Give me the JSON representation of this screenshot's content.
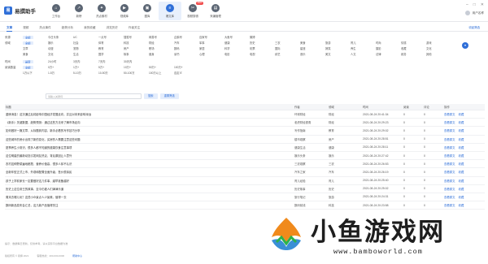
{
  "app": {
    "logo_text": "易",
    "name": "易撰助手"
  },
  "nav": [
    {
      "label": "工作台",
      "icon": "home-icon",
      "glyph": "⌂"
    },
    {
      "label": "新榜",
      "icon": "trend-icon",
      "glyph": "↗"
    },
    {
      "label": "热点素材",
      "icon": "fire-icon",
      "glyph": "✦"
    },
    {
      "label": "视频库",
      "icon": "video-icon",
      "glyph": "▶"
    },
    {
      "label": "图库",
      "icon": "image-icon",
      "glyph": "▣"
    },
    {
      "label": "爆文库",
      "icon": "article-icon",
      "glyph": "≡",
      "active": true
    },
    {
      "label": "视频剪辑",
      "icon": "scissors-icon",
      "glyph": "✂",
      "badge": "NEW"
    },
    {
      "label": "采编管理",
      "icon": "folder-icon",
      "glyph": "▤"
    }
  ],
  "window": {
    "min": "–",
    "max": "□",
    "close": "✕"
  },
  "user": {
    "name": "用户名称"
  },
  "tabs": [
    "文章",
    "视频",
    "热点事件",
    "趋势分析",
    "我的收藏",
    "浏览历史",
    "作者关注"
  ],
  "tabs_right": "收起筛选",
  "filters": {
    "source": {
      "label": "来源",
      "options": [
        "全部",
        "今日头条",
        "UC",
        "一点号",
        "搜狐号",
        "网易号",
        "企鹅号",
        "百家号",
        "大鱼号",
        "微博"
      ]
    },
    "category": {
      "label": "领域",
      "rows": [
        [
          "全部",
          "娱乐",
          "社会",
          "体育",
          "科技",
          "财经",
          "汽车",
          "军事",
          "健康",
          "历史",
          "三农",
          "美食",
          "旅游",
          "育儿",
          "时尚",
          "情感",
          "游戏"
        ],
        [
          "文章",
          "动漫",
          "宠物",
          "教育",
          "房产",
          "职场",
          "数码",
          "家居",
          "科学",
          "彩票",
          "国际",
          "星座",
          "搞笑",
          "养生",
          "摄影",
          "收藏",
          "文化"
        ],
        [
          "美食",
          "文化",
          "生活",
          "国学",
          "故事",
          "健身",
          "读书",
          "心理",
          "电影",
          "电视",
          "综艺",
          "音乐",
          "美文",
          "人文",
          "法律",
          "政务",
          "其他"
        ]
      ]
    },
    "time": {
      "label": "时间",
      "options": [
        "最新",
        "24小时",
        "3天内",
        "7天内",
        "30天内"
      ]
    },
    "read": {
      "label": "阅读数量",
      "rows": [
        [
          "全部",
          "0万+",
          "1万+",
          "5万+",
          "10万+",
          "50万+",
          "100万+"
        ],
        [
          "1万以下",
          "1-5万",
          "5-10万",
          "10-50万",
          "50-100万",
          "100万以上",
          "自定义"
        ]
      ]
    }
  },
  "search": {
    "placeholder": "请输入关键词",
    "button": "搜索",
    "reset": "重置筛选"
  },
  "table": {
    "headers": {
      "title": "标题",
      "author": "作者",
      "category": "领域",
      "time": "时间",
      "read": "阅读",
      "comment": "评论",
      "op": "操作"
    },
    "rows": [
      {
        "title": "重磅消息！这次通过后将影响中国经济发展走向，并且对未来影响深远",
        "author": "环球财经",
        "category": "财经",
        "time": "2021-08-24 20:41:34",
        "read": "0",
        "comment": "0",
        "op1": "查看原文",
        "op2": "收藏"
      },
      {
        "title": "《新手》关键数据，趋势预测：通过这些方法来了解市场走向",
        "author": "老虎财经视角",
        "category": "财经",
        "time": "2021-08-24 20:29:23",
        "read": "0",
        "comment": "0",
        "op1": "查看原文",
        "op2": "收藏"
      },
      {
        "title": "如何做好一篇文章，从标题到内容，新手必看的写作技巧分享",
        "author": "写作指南",
        "category": "教育",
        "time": "2021-08-24 20:29:02",
        "read": "0",
        "comment": "0",
        "op1": "查看原文",
        "op2": "收藏"
      },
      {
        "title": "这些城市的房价出现了新的变化，买房的人需要注意这些问题",
        "author": "楼市观察",
        "category": "房产",
        "time": "2021-08-24 20:28:51",
        "read": "0",
        "comment": "0",
        "op1": "查看原文",
        "op2": "收藏"
      },
      {
        "title": "夏季养生小常识，很多人都不知道的健康饮食注意事项",
        "author": "健康生活",
        "category": "健康",
        "time": "2021-08-24 20:28:11",
        "read": "0",
        "comment": "0",
        "op1": "查看原文",
        "op2": "收藏"
      },
      {
        "title": "这位明星的最新动态引发网友热议，背后原因让人意外",
        "author": "娱乐头条",
        "category": "娱乐",
        "time": "2021-08-24 20:27:42",
        "read": "0",
        "comment": "0",
        "op1": "查看原文",
        "op2": "收藏"
      },
      {
        "title": "农村这种野菜遍地都是，营养价值高，很多人却不认识",
        "author": "三农观察",
        "category": "三农",
        "time": "2021-08-24 20:26:53",
        "read": "0",
        "comment": "0",
        "op1": "查看原文",
        "op2": "收藏"
      },
      {
        "title": "全新车型正式上市，外观和配置全面升级，售价很亲民",
        "author": "汽车之家",
        "category": "汽车",
        "time": "2021-08-24 20:26:19",
        "read": "0",
        "comment": "0",
        "op1": "查看原文",
        "op2": "收藏"
      },
      {
        "title": "孩子上学前家长一定要做好这几件事，越早准备越好",
        "author": "育儿经验",
        "category": "育儿",
        "time": "2021-08-24 20:25:40",
        "read": "0",
        "comment": "0",
        "op1": "查看原文",
        "op2": "收藏"
      },
      {
        "title": "历史上这位帝王的故事，至今仍被人们津津乐道",
        "author": "历史故事",
        "category": "历史",
        "time": "2021-08-24 20:25:02",
        "read": "0",
        "comment": "0",
        "op1": "查看原文",
        "op2": "收藏"
      },
      {
        "title": "周末去哪儿玩？这些小众景点人少景美，值得一去",
        "author": "旅行笔记",
        "category": "旅游",
        "time": "2021-08-24 20:24:31",
        "read": "0",
        "comment": "0",
        "op1": "查看原文",
        "op2": "收藏"
      },
      {
        "title": "数码新品发布会汇总，这几款产品值得关注",
        "author": "数码前线",
        "category": "科技",
        "time": "2021-08-24 20:23:58",
        "read": "0",
        "comment": "0",
        "op1": "查看原文",
        "op2": "收藏"
      }
    ]
  },
  "footnote": "提示：数据每日更新，仅供参考，请以实际平台数据为准",
  "footer": {
    "text1": "版权所有 © 易撰 2021",
    "text2": "客服热线：400-000-0000",
    "link": "帮助中心"
  },
  "watermark": {
    "text": "小鱼游戏网",
    "url": "www.bamboworld.com"
  }
}
